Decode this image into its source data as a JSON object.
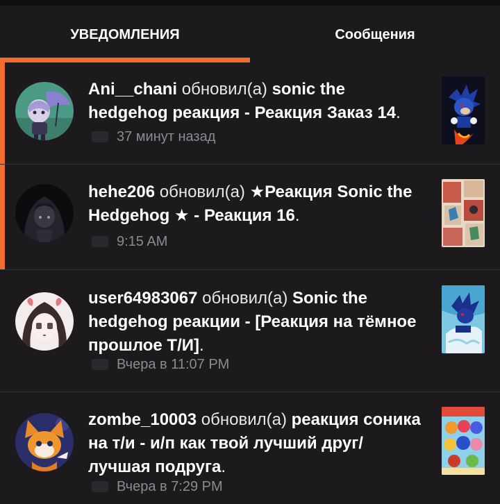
{
  "tabs": {
    "notifications": "УВЕДОМЛЕНИЯ",
    "messages": "Сообщения"
  },
  "accent_color": "#f26c2c",
  "notifications": [
    {
      "user": "Ani__chani",
      "verb": "обновил(а)",
      "title": "sonic the hedgehog реакция - Реакция Заказ 14",
      "time": "37 минут назад",
      "unread": true
    },
    {
      "user": "hehe206",
      "verb": "обновил(а)",
      "title": "★Реакция Sonic the Hedgehog ★ - Реакция 16",
      "time": "9:15 AM",
      "unread": true
    },
    {
      "user": "user64983067",
      "verb": "обновил(а)",
      "title": "Sonic the hedgehog реакции - [Реакция на тёмное прошлое Т/И]",
      "time": "Вчера в 11:07 PM",
      "unread": false
    },
    {
      "user": "zombe_10003",
      "verb": "обновил(а)",
      "title": "реакция соника на т/и - и/п как твой лучший друг/лучшая подруга",
      "time": "Вчера в 7:29 PM",
      "unread": false
    }
  ]
}
